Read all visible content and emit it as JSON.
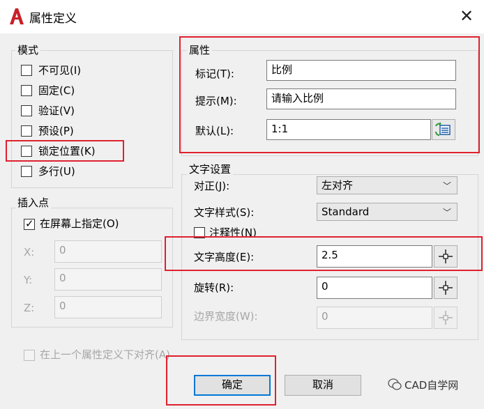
{
  "window": {
    "title": "属性定义",
    "close_glyph": "✕"
  },
  "mode": {
    "label": "模式",
    "items": [
      {
        "label": "不可见(I)",
        "checked": false
      },
      {
        "label": "固定(C)",
        "checked": false
      },
      {
        "label": "验证(V)",
        "checked": false
      },
      {
        "label": "预设(P)",
        "checked": false
      },
      {
        "label": "锁定位置(K)",
        "checked": false
      },
      {
        "label": "多行(U)",
        "checked": false
      }
    ]
  },
  "attribute": {
    "label": "属性",
    "tag_label": "标记(T):",
    "tag_value": "比例",
    "prompt_label": "提示(M):",
    "prompt_value": "请输入比例",
    "default_label": "默认(L):",
    "default_value": "1:1"
  },
  "insert": {
    "label": "插入点",
    "specify_label": "在屏幕上指定(O)",
    "specify_checked": true,
    "x_label": "X:",
    "x_value": "0",
    "y_label": "Y:",
    "y_value": "0",
    "z_label": "Z:",
    "z_value": "0"
  },
  "text": {
    "label": "文字设置",
    "justify_label": "对正(J):",
    "justify_value": "左对齐",
    "style_label": "文字样式(S):",
    "style_value": "Standard",
    "annotative_label": "注释性(N)",
    "height_label": "文字高度(E):",
    "height_value": "2.5",
    "rotation_label": "旋转(R):",
    "rotation_value": "0",
    "boundary_label": "边界宽度(W):",
    "boundary_value": "0"
  },
  "align_below_label": "在上一个属性定义下对齐(A)",
  "buttons": {
    "ok": "确定",
    "cancel": "取消"
  },
  "watermark": "CAD自学网",
  "colors": {
    "highlight": "#e0202e",
    "app_icon": "#c8202a",
    "focus": "#0078d7"
  }
}
